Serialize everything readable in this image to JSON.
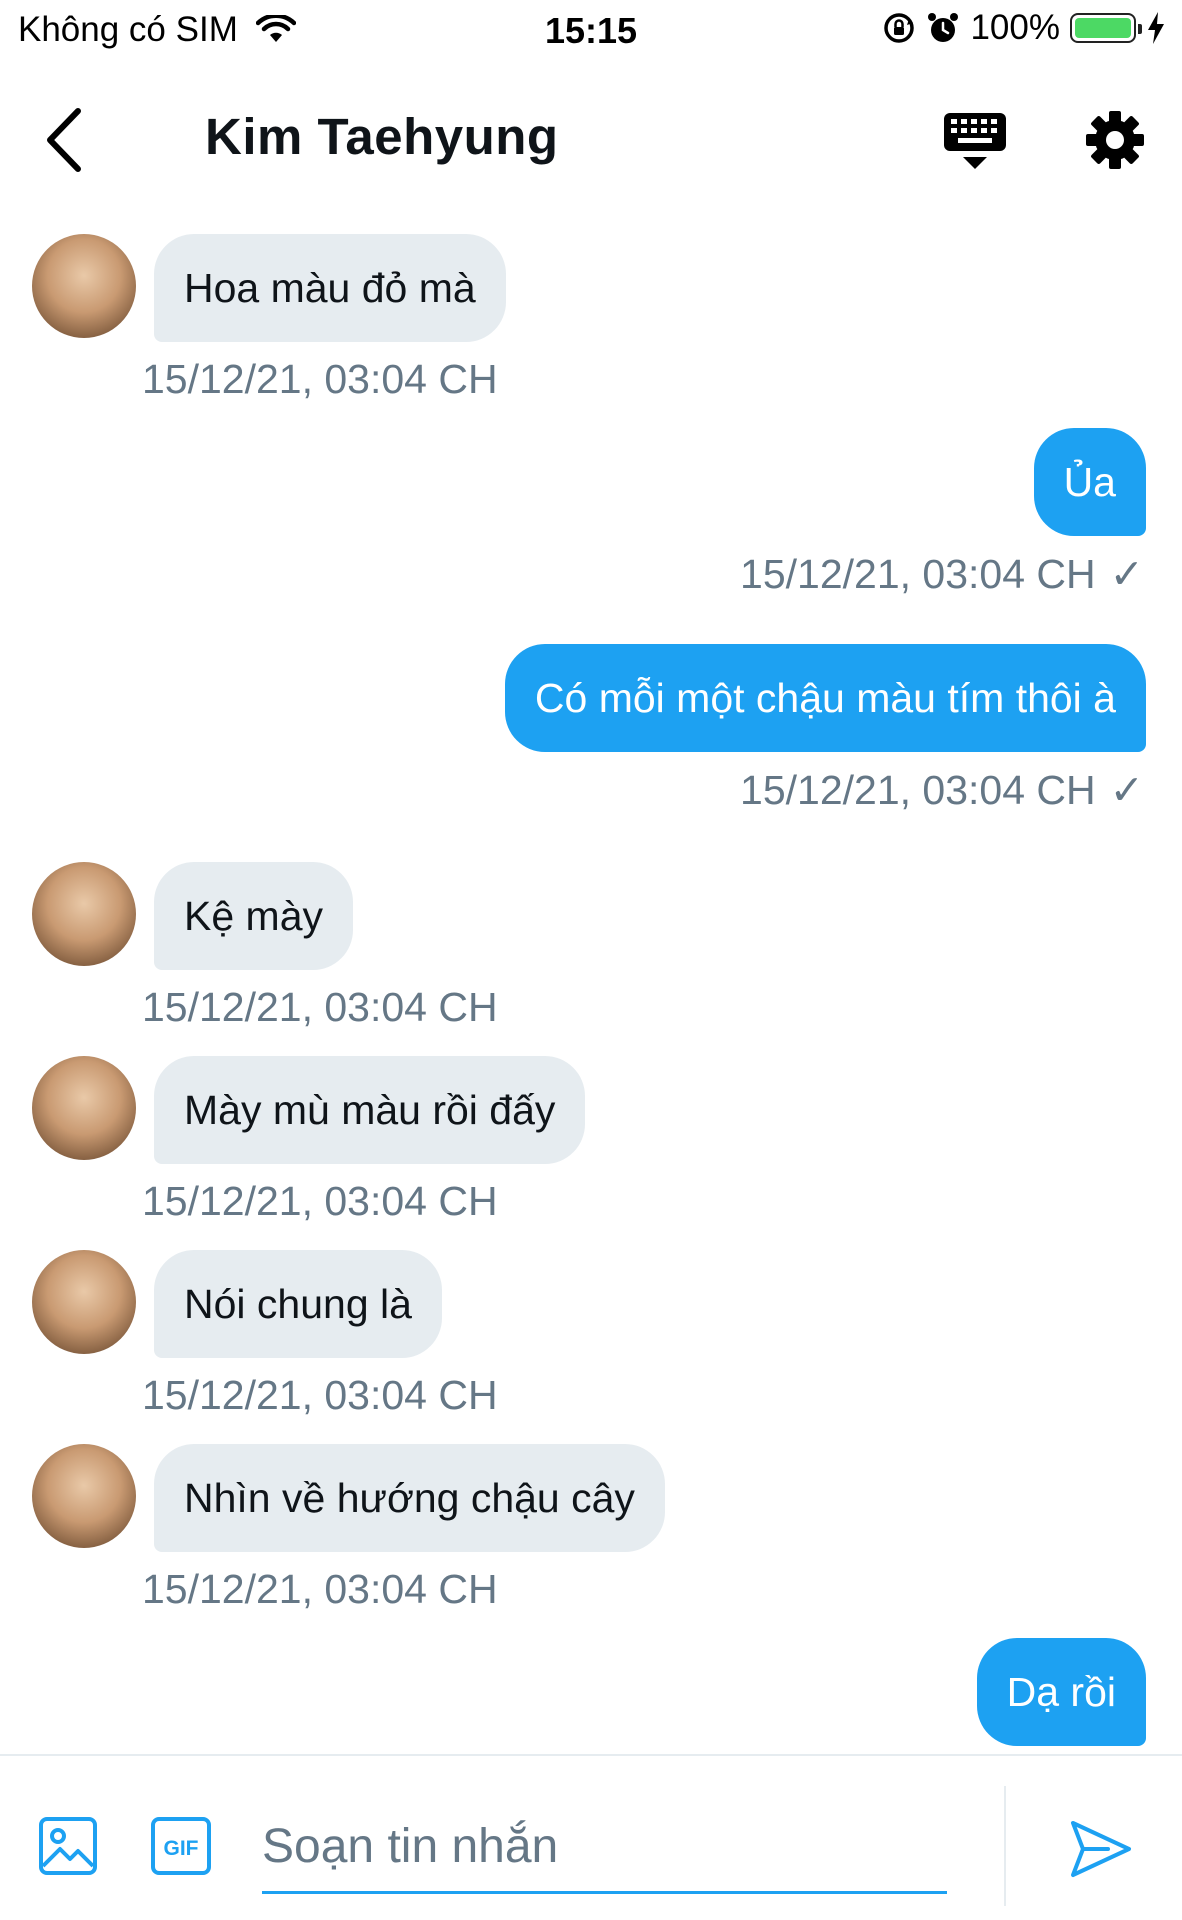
{
  "status_bar": {
    "carrier": "Không có SIM",
    "time": "15:15",
    "battery": "100%",
    "battery_level": 1.0
  },
  "header": {
    "title": "Kim Taehyung"
  },
  "messages": [
    {
      "direction": "in",
      "text": "Hoa màu đỏ mà",
      "timestamp": "15/12/21, 03:04 CH"
    },
    {
      "direction": "out",
      "text": "Ủa",
      "timestamp": "15/12/21, 03:04 CH",
      "read_mark": "✓"
    },
    {
      "direction": "out",
      "text": "Có mỗi một chậu màu tím thôi à",
      "timestamp": "15/12/21, 03:04 CH",
      "read_mark": "✓"
    },
    {
      "direction": "in",
      "text": "Kệ mày",
      "timestamp": "15/12/21, 03:04 CH"
    },
    {
      "direction": "in",
      "text": "Mày mù màu rồi đấy",
      "timestamp": "15/12/21, 03:04 CH"
    },
    {
      "direction": "in",
      "text": "Nói chung là",
      "timestamp": "15/12/21, 03:04 CH"
    },
    {
      "direction": "in",
      "text": "Nhìn về hướng chậu cây",
      "timestamp": "15/12/21, 03:04 CH"
    },
    {
      "direction": "out",
      "text": "Dạ rồi"
    }
  ],
  "composer": {
    "placeholder": "Soạn tin nhắn",
    "value": "",
    "gif_label": "GIF"
  },
  "colors": {
    "accent": "#1da1f2",
    "incoming_bubble": "#e6ecf0",
    "timestamp": "#657786",
    "battery": "#4cd964"
  },
  "icons": {
    "back": "chevron-left-icon",
    "keyboard": "keyboard-icon",
    "settings": "gear-icon",
    "image": "image-icon",
    "gif": "gif-icon",
    "send": "send-icon",
    "wifi": "wifi-icon",
    "rotation_lock": "rotation-lock-icon",
    "alarm": "alarm-icon",
    "charging": "charging-bolt-icon"
  }
}
